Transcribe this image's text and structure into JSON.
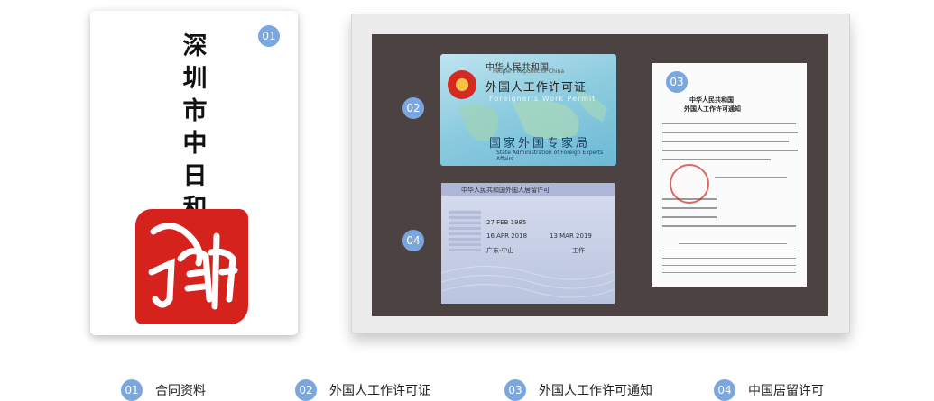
{
  "contract_card": {
    "badge": "01",
    "title": "深圳市中日和"
  },
  "documents": {
    "permit": {
      "badge": "02",
      "country": "中华人民共和国",
      "country_en": "People's Republic of China",
      "title_cn": "外国人工作许可证",
      "title_en": "Foreigner's Work Permit",
      "issuer": "国家外国专家局",
      "issuer_en": "State Administration of Foreign Experts Affairs"
    },
    "notice": {
      "badge": "03",
      "heading1": "中华人民共和国",
      "heading2": "外国人工作许可通知"
    },
    "residence": {
      "badge": "04",
      "header": "中华人民共和国外国人居留许可",
      "dates": [
        "27 FEB 1985",
        "16 APR 2018",
        "13 MAR 2019"
      ],
      "place": "广东·中山",
      "purpose": "工作"
    }
  },
  "legend": [
    {
      "num": "01",
      "label": "合同资料"
    },
    {
      "num": "02",
      "label": "外国人工作许可证"
    },
    {
      "num": "03",
      "label": "外国人工作许可通知"
    },
    {
      "num": "04",
      "label": "中国居留许可"
    }
  ]
}
